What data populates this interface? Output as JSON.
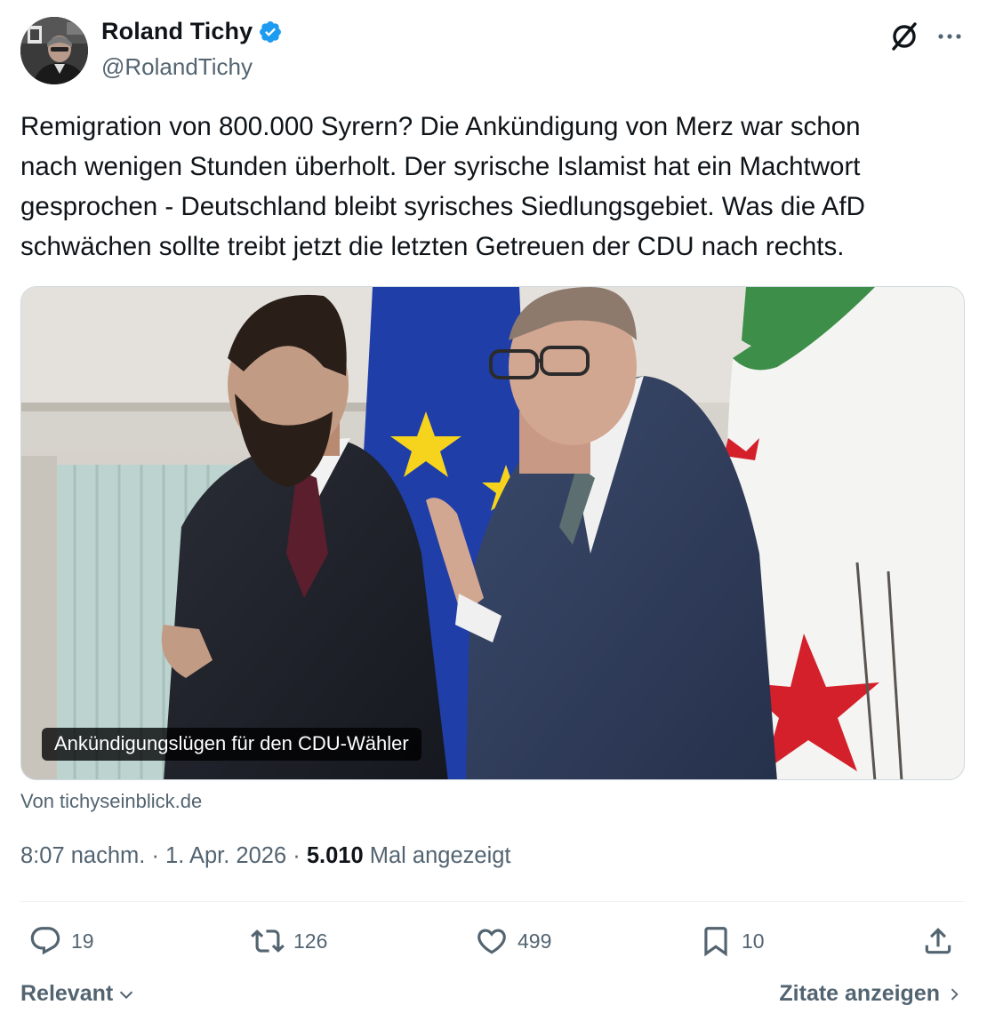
{
  "author": {
    "display_name": "Roland Tichy",
    "handle": "@RolandTichy",
    "verified": true
  },
  "tweet": {
    "text": "Remigration von 800.000 Syrern? Die Ankündigung von Merz war schon\nnach wenigen Stunden überholt. Der syrische Islamist hat ein Machtwort\ngesprochen - Deutschland bleibt syrisches Siedlungsgebiet. Was die AfD\nschwächen sollte treibt jetzt die letzten Getreuen der CDU nach rechts."
  },
  "media": {
    "caption": "Ankündigungslügen für den CDU-Wähler",
    "source": "Von tichyseinblick.de"
  },
  "meta": {
    "time": "8:07 nachm.",
    "separator": "·",
    "date": "1. Apr. 2026",
    "views_count": "5.010",
    "views_label": "Mal angezeigt"
  },
  "actions": {
    "replies": "19",
    "reposts": "126",
    "likes": "499",
    "bookmarks": "10"
  },
  "footer": {
    "sort_label": "Relevant",
    "quotes_label": "Zitate anzeigen"
  },
  "colors": {
    "text_primary": "#0f1419",
    "text_secondary": "#536471",
    "verified_blue": "#1d9bf0",
    "divider": "#eff3f4"
  },
  "icons": {
    "verified": "verified-badge-icon",
    "grok": "grok-icon",
    "more": "more-dots-icon",
    "reply": "reply-bubble-icon",
    "repost": "repost-arrows-icon",
    "like": "heart-icon",
    "bookmark": "bookmark-icon",
    "share": "share-upload-icon",
    "chevron_down": "chevron-down-icon",
    "chevron_right": "chevron-right-icon"
  }
}
